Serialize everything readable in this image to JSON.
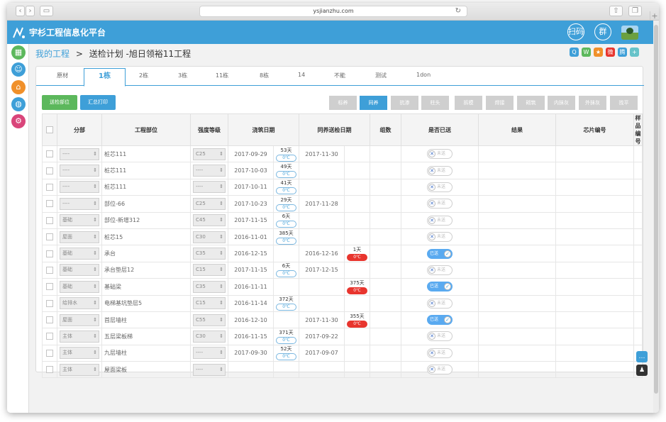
{
  "browser": {
    "url": "ysjianzhu.com"
  },
  "app": {
    "title": "宇杉工程信息化平台",
    "icon_qr": "扫码",
    "icon_group": "群"
  },
  "breadcrumb": {
    "link": "我的工程",
    "sep": ">",
    "current": "送检计划 -旭日领裕11工程"
  },
  "tabs": [
    "原材",
    "1栋",
    "2栋",
    "3栋",
    "11栋",
    "8栋",
    "14",
    "不能",
    "测试",
    "1don"
  ],
  "actions": {
    "send": "送检部位",
    "print": "汇总打印"
  },
  "filters": [
    "标养",
    "同养",
    "抗渗",
    "柱头",
    "拆模",
    "焊接",
    "砌筑",
    "内抹灰",
    "外抹灰",
    "找平"
  ],
  "columns": [
    "分部",
    "工程部位",
    "强度等级",
    "浇筑日期",
    "同养送检日期",
    "组数",
    "是否已送",
    "结果",
    "芯片编号",
    "样品编号"
  ],
  "rows": [
    {
      "div": "----",
      "part": "桩芯111",
      "grade": "C25",
      "date": "2017-09-29",
      "days": "53天",
      "temp": "0℃",
      "send": "2017-11-30",
      "s_days": "",
      "s_temp": "",
      "sent": false
    },
    {
      "div": "----",
      "part": "桩芯111",
      "grade": "----",
      "date": "2017-10-03",
      "days": "49天",
      "temp": "0℃",
      "send": "",
      "s_days": "",
      "s_temp": "",
      "sent": false
    },
    {
      "div": "----",
      "part": "桩芯111",
      "grade": "----",
      "date": "2017-10-11",
      "days": "41天",
      "temp": "0℃",
      "send": "",
      "s_days": "",
      "s_temp": "",
      "sent": false
    },
    {
      "div": "----",
      "part": "部位-66",
      "grade": "C25",
      "date": "2017-10-23",
      "days": "29天",
      "temp": "0℃",
      "send": "2017-11-28",
      "s_days": "",
      "s_temp": "",
      "sent": false
    },
    {
      "div": "基础",
      "part": "部位-新增312",
      "grade": "C45",
      "date": "2017-11-15",
      "days": "6天",
      "temp": "0℃",
      "send": "",
      "s_days": "",
      "s_temp": "",
      "sent": false
    },
    {
      "div": "屋面",
      "part": "桩芯15",
      "grade": "C30",
      "date": "2016-11-01",
      "days": "385天",
      "temp": "0℃",
      "send": "",
      "s_days": "",
      "s_temp": "",
      "sent": false
    },
    {
      "div": "基础",
      "part": "承台",
      "grade": "C35",
      "date": "2016-12-15",
      "days": "",
      "temp": "",
      "send": "2016-12-16",
      "s_days": "1天",
      "s_temp": "0℃",
      "sent": true
    },
    {
      "div": "基础",
      "part": "承台垫层12",
      "grade": "C15",
      "date": "2017-11-15",
      "days": "6天",
      "temp": "0℃",
      "send": "2017-12-15",
      "s_days": "",
      "s_temp": "",
      "sent": false
    },
    {
      "div": "基础",
      "part": "基础梁",
      "grade": "C35",
      "date": "2016-11-11",
      "days": "",
      "temp": "",
      "send": "",
      "s_days": "375天",
      "s_temp": "0℃",
      "sent": true
    },
    {
      "div": "给排水",
      "part": "电梯基坑垫层5",
      "grade": "C15",
      "date": "2016-11-14",
      "days": "372天",
      "temp": "0℃",
      "send": "",
      "s_days": "",
      "s_temp": "",
      "sent": false
    },
    {
      "div": "屋面",
      "part": "首层墙柱",
      "grade": "C55",
      "date": "2016-12-10",
      "days": "",
      "temp": "",
      "send": "2017-11-30",
      "s_days": "355天",
      "s_temp": "0℃",
      "sent": true
    },
    {
      "div": "主体",
      "part": "五层梁板梯",
      "grade": "C30",
      "date": "2016-11-15",
      "days": "371天",
      "temp": "0℃",
      "send": "2017-09-22",
      "s_days": "",
      "s_temp": "",
      "sent": false
    },
    {
      "div": "主体",
      "part": "九层墙柱",
      "grade": "----",
      "date": "2017-09-30",
      "days": "52天",
      "temp": "0℃",
      "send": "2017-09-07",
      "s_days": "",
      "s_temp": "",
      "sent": false
    },
    {
      "div": "主体",
      "part": "屋面梁板",
      "grade": "----",
      "date": "",
      "days": "",
      "temp": "",
      "send": "",
      "s_days": "",
      "s_temp": "",
      "sent": false
    }
  ],
  "toggle": {
    "on": "已送",
    "off": "未送"
  },
  "colors": {
    "primary": "#3e9fd8",
    "green": "#5cb85c",
    "red": "#e8352e"
  }
}
